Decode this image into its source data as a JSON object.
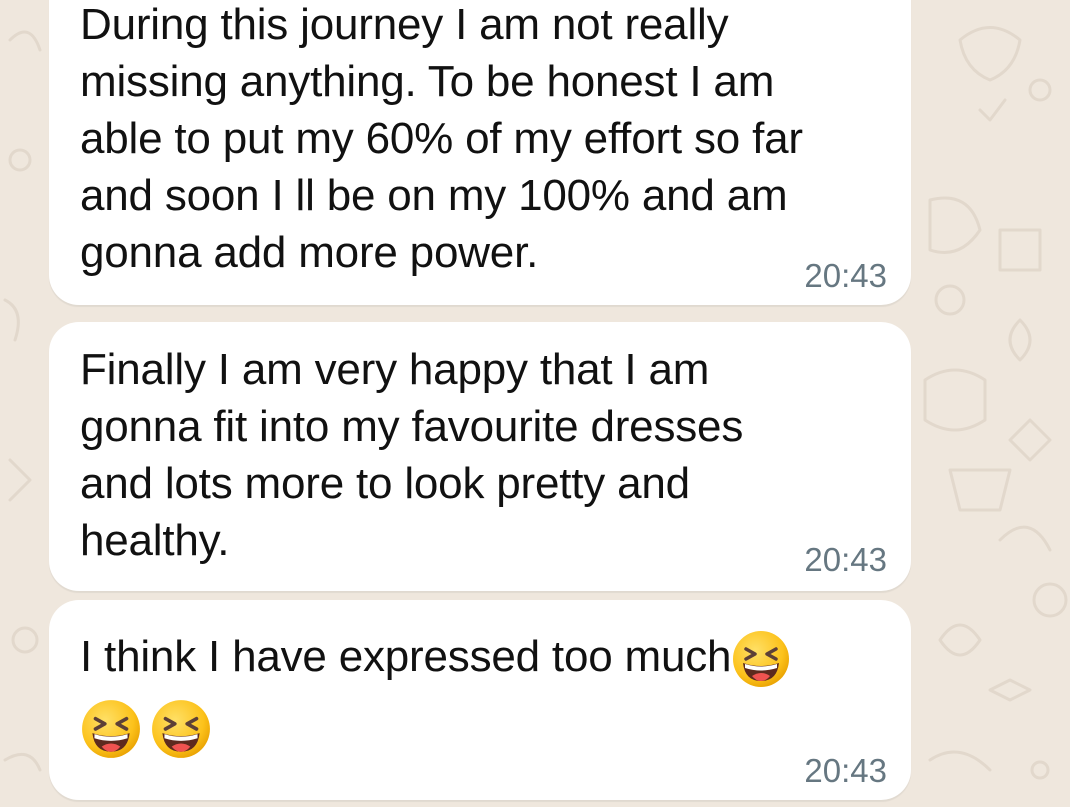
{
  "messages": [
    {
      "lines": [
        "During this journey I am not really",
        "missing anything. To be honest I am",
        "able to put my 60% of my effort so far",
        "and soon I ll be on my 100% and am",
        "gonna add more power."
      ],
      "time": "20:43"
    },
    {
      "lines": [
        "Finally I am very happy that I am",
        "gonna fit into my favourite dresses",
        "and lots more to look pretty and",
        "healthy."
      ],
      "time": "20:43"
    },
    {
      "text": "I think I have expressed too much",
      "emoji_name": "grinning-squinting-face-emoji",
      "time": "20:43"
    }
  ],
  "colors": {
    "wallpaper": "#efe7dd",
    "bubble": "#ffffff",
    "text": "#111111",
    "timestamp": "#667781"
  }
}
